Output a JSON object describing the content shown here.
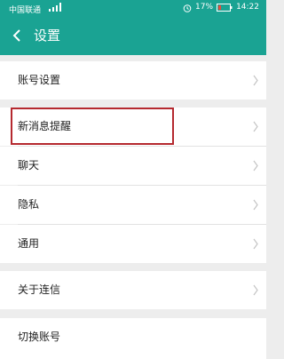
{
  "status": {
    "carrier": "中国联通",
    "battery": "17%",
    "time": "14:22"
  },
  "header": {
    "title": "设置"
  },
  "menu": [
    {
      "label": "账号设置"
    },
    {
      "label": "新消息提醒"
    },
    {
      "label": "聊天"
    },
    {
      "label": "隐私"
    },
    {
      "label": "通用"
    },
    {
      "label": "关于连信"
    },
    {
      "label": "切换账号"
    }
  ],
  "colors": {
    "header_bg": "#1aa393",
    "highlight_border": "#b5292f"
  }
}
